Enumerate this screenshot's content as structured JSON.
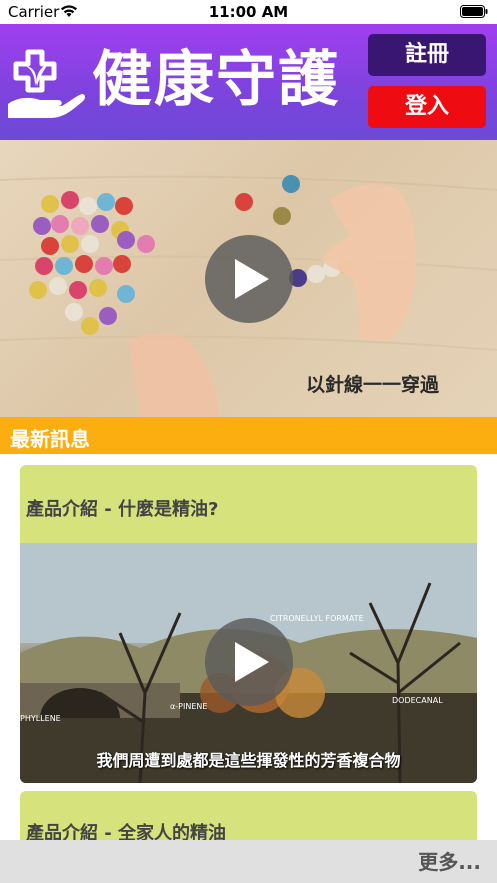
{
  "status_bar": {
    "carrier": "Carrier",
    "time": "11:00 AM"
  },
  "header": {
    "title": "健康守護",
    "register_label": "註冊",
    "login_label": "登入",
    "colors": {
      "register": "#3a1673",
      "login": "#ee0b12",
      "header_top": "#a03ff0",
      "header_bottom": "#6c4ad6"
    }
  },
  "hero": {
    "caption": "以針線一一穿過"
  },
  "news": {
    "section_title": "最新訊息",
    "section_color": "#fcad10",
    "items": [
      {
        "title": "產品介紹 - 什麼是精油?",
        "video_subtitle": "我們周遭到處都是這些揮發性的芳香複合物"
      },
      {
        "title": "產品介紹 - 全家人的精油"
      }
    ],
    "card_color": "#d6e37c"
  },
  "footer": {
    "more_label": "更多..."
  }
}
